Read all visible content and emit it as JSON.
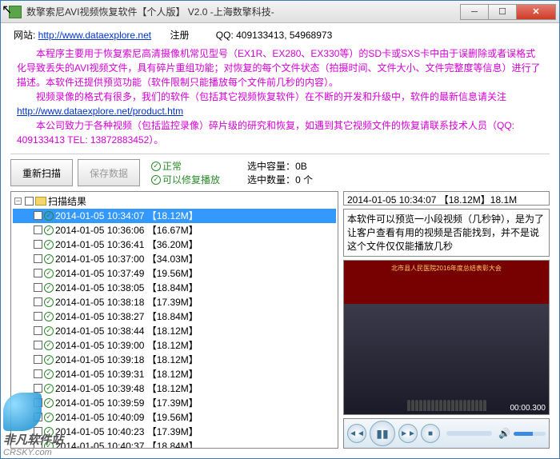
{
  "window": {
    "title": "数擎索尼AVI视频恢复软件【个人版】 V2.0  -上海数擎科技-"
  },
  "header": {
    "site_label": "网站: ",
    "site_url": "http://www.dataexplore.net",
    "register": "注册",
    "qq_label": "QQ: 409133413, 54968973"
  },
  "desc": {
    "p1": "　　本程序主要用于恢复索尼高清摄像机常见型号（EX1R、EX280、EX330等）的SD卡或SXS卡中由于误删除或者误格式化导致丢失的AVI视频文件，具有碎片重组功能；对恢复的每个文件状态（拍摄时间、文件大小、文件完整度等信息）进行了描述。本软件还提供预览功能（软件限制只能播放每个文件前几秒的内容）。",
    "p2_1": "　　视频录像的格式有很多，我们的软件（包括其它视频恢复软件）在不断的开发和升级中，软件的最新信息请关注 ",
    "p2_link": "http://www.dataexplore.net/product.htm",
    "p3": "　　本公司致力于各种视频（包括监控录像）碎片级的研究和恢复，如遇到其它视频文件的恢复请联系技术人员（QQ: 409133413  TEL: 13872883452）。"
  },
  "toolbar": {
    "rescan": "重新扫描",
    "save": "保存数据",
    "legend_ok": "正常",
    "legend_fix": "可以修复播放",
    "sel_cap_label": "选中容量：",
    "sel_cap_value": "0B",
    "sel_cnt_label": "选中数量：",
    "sel_cnt_value": "0 个"
  },
  "tree": {
    "root": "扫描结果",
    "items": [
      {
        "label": "2014-01-05 10:34:07 【18.12M】",
        "selected": true
      },
      {
        "label": "2014-01-05 10:36:06 【16.67M】"
      },
      {
        "label": "2014-01-05 10:36:41 【36.20M】"
      },
      {
        "label": "2014-01-05 10:37:00 【34.03M】"
      },
      {
        "label": "2014-01-05 10:37:49 【19.56M】"
      },
      {
        "label": "2014-01-05 10:38:05 【18.84M】"
      },
      {
        "label": "2014-01-05 10:38:18 【17.39M】"
      },
      {
        "label": "2014-01-05 10:38:27 【18.84M】"
      },
      {
        "label": "2014-01-05 10:38:44 【18.12M】"
      },
      {
        "label": "2014-01-05 10:39:00 【18.12M】"
      },
      {
        "label": "2014-01-05 10:39:18 【18.12M】"
      },
      {
        "label": "2014-01-05 10:39:31 【18.12M】"
      },
      {
        "label": "2014-01-05 10:39:48 【18.12M】"
      },
      {
        "label": "2014-01-05 10:39:59 【17.39M】"
      },
      {
        "label": "2014-01-05 10:40:09 【19.56M】"
      },
      {
        "label": "2014-01-05 10:40:23 【17.39M】"
      },
      {
        "label": "2014-01-05 10:40:37 【18.84M】"
      }
    ]
  },
  "detail": {
    "info": "2014-01-05 10:34:07 【18.12M】18.1M",
    "note": "本软件可以预览一小段视频（几秒钟），是为了让客户查看有用的视频是否能找到，并不是说这个文件仅仅能播放几秒",
    "banner": "北市县人民医院2016年度总结表彰大会",
    "timer": "00:00.300"
  },
  "watermark": {
    "cn": "非凡软件站",
    "url": "CRSKY.com"
  }
}
